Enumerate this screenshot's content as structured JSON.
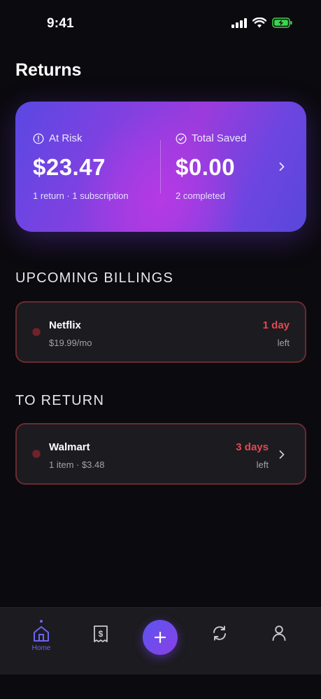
{
  "status_bar": {
    "time": "9:41"
  },
  "page": {
    "title": "Returns"
  },
  "summary": {
    "at_risk": {
      "label": "At Risk",
      "value": "$23.47",
      "sub": "1 return · 1 subscription"
    },
    "saved": {
      "label": "Total Saved",
      "value": "$0.00",
      "sub": "2 completed"
    }
  },
  "sections": {
    "upcoming": {
      "title": "UPCOMING BILLINGS",
      "items": [
        {
          "name": "Netflix",
          "detail": "$19.99/mo",
          "due": "1 day",
          "due_sub": "left"
        }
      ]
    },
    "to_return": {
      "title": "TO RETURN",
      "items": [
        {
          "name": "Walmart",
          "detail": "1 item · $3.48",
          "due": "3 days",
          "due_sub": "left"
        }
      ]
    }
  },
  "tabbar": {
    "home_label": "Home",
    "icons": [
      "home-icon",
      "receipt-icon",
      "plus-icon",
      "sync-icon",
      "profile-icon"
    ]
  },
  "colors": {
    "accent": "#6d63f2",
    "urgent": "#e2494f",
    "card_border": "#6a2a31",
    "background": "#0b0a0e"
  }
}
